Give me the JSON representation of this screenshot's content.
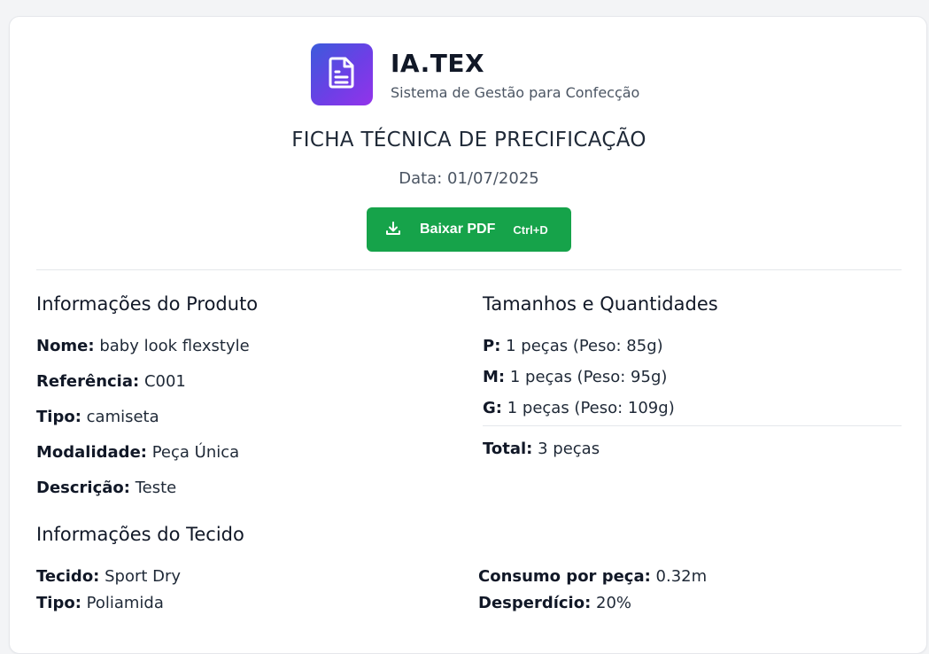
{
  "brand": {
    "title": "IA.TEX",
    "subtitle": "Sistema de Gestão para Confecção",
    "icon": "document-icon",
    "gradient": [
      "#3b5bdb",
      "#9333ea"
    ]
  },
  "document": {
    "title": "FICHA TÉCNICA DE PRECIFICAÇÃO",
    "date": "Data: 01/07/2025"
  },
  "pdf_button": {
    "label": "Baixar PDF",
    "shortcut": "Ctrl+D",
    "icon": "download-icon",
    "color": "#16a34a"
  },
  "product": {
    "heading": "Informações do Produto",
    "fields": [
      {
        "label": "Nome:",
        "value": "baby look flexstyle"
      },
      {
        "label": "Referência:",
        "value": "C001"
      },
      {
        "label": "Tipo:",
        "value": "camiseta"
      },
      {
        "label": "Modalidade:",
        "value": "Peça Única"
      },
      {
        "label": "Descrição:",
        "value": "Teste"
      }
    ]
  },
  "sizes": {
    "heading": "Tamanhos e Quantidades",
    "items": [
      {
        "label": "P:",
        "value": "1 peças (Peso: 85g)"
      },
      {
        "label": "M:",
        "value": "1 peças (Peso: 95g)"
      },
      {
        "label": "G:",
        "value": "1 peças (Peso: 109g)"
      }
    ],
    "total": {
      "label": "Total:",
      "value": "3 peças"
    }
  },
  "fabric": {
    "heading": "Informações do Tecido",
    "left": [
      {
        "label": "Tecido:",
        "value": "Sport Dry"
      },
      {
        "label": "Tipo:",
        "value": "Poliamida"
      }
    ],
    "right": [
      {
        "label": "Consumo por peça:",
        "value": "0.32m"
      },
      {
        "label": "Desperdício:",
        "value": "20%"
      }
    ]
  }
}
